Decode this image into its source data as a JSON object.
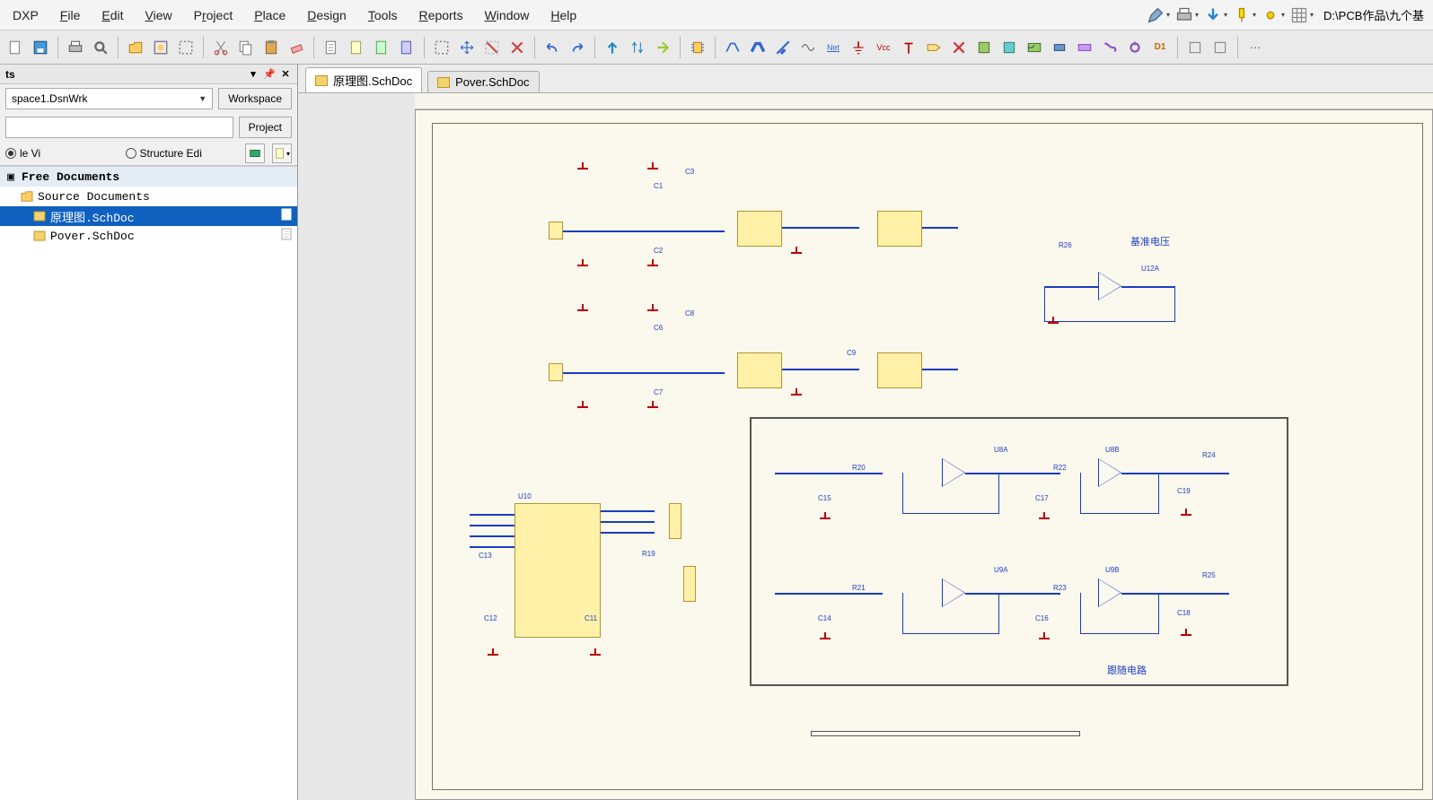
{
  "menu": {
    "dxp": "DXP",
    "file": "File",
    "edit": "Edit",
    "view": "View",
    "project": "Project",
    "place": "Place",
    "design": "Design",
    "tools": "Tools",
    "reports": "Reports",
    "window": "Window",
    "help": "Help"
  },
  "path_label": "D:\\PCB作品\\九个基",
  "sidebar": {
    "panel_title": "ts",
    "workspace_value": "space1.DsnWrk",
    "workspace_btn": "Workspace",
    "project_btn": "Project",
    "radio_file_view": "le Vi",
    "radio_structure": "Structure Edi",
    "tree": {
      "group": "Free Documents",
      "folder": "Source Documents",
      "doc1": "原理图.SchDoc",
      "doc2": "Pover.SchDoc"
    }
  },
  "tabs": [
    {
      "label": "原理图.SchDoc",
      "active": true
    },
    {
      "label": "Pover.SchDoc",
      "active": false
    }
  ],
  "schematic": {
    "labels": {
      "c1": "C1",
      "c2": "C2",
      "c3": "C3",
      "c6": "C6",
      "c7": "C7",
      "c8": "C8",
      "c9": "C9",
      "c11": "C11",
      "c12": "C12",
      "c13": "C13",
      "c14": "C14",
      "c15": "C15",
      "c16": "C16",
      "c17": "C17",
      "c18": "C18",
      "c19": "C19",
      "r19": "R19",
      "r20": "R20",
      "r21": "R21",
      "r22": "R22",
      "r23": "R23",
      "r24": "R24",
      "r25": "R25",
      "r26": "R26",
      "u8a": "U8A",
      "u8b": "U8B",
      "u9a": "U9A",
      "u9b": "U9B",
      "u10": "U10",
      "u12a": "U12A",
      "ref_v_title": "基准电压",
      "section_title": "跟随电路"
    }
  },
  "toolbar_icons": [
    "new",
    "open",
    "save",
    "sep",
    "print",
    "preview",
    "sep",
    "zoom-fit",
    "zoom-area",
    "sep",
    "cut",
    "copy",
    "paste",
    "sep",
    "undo",
    "redo",
    "sep",
    "select",
    "move",
    "sep",
    "grid",
    "snap",
    "sep",
    "cross",
    "sep",
    "align-l",
    "align-r",
    "sep",
    "mirror",
    "rotate",
    "sep",
    "place-part",
    "net-label",
    "power-port",
    "gnd",
    "vcc",
    "wire",
    "bus",
    "port",
    "sheet-entry",
    "harness",
    "sep",
    "sheet",
    "sep",
    "box1",
    "box2"
  ],
  "right_menu_icons": [
    "pencil",
    "print",
    "down-arrow",
    "pin",
    "cross",
    "grid"
  ]
}
